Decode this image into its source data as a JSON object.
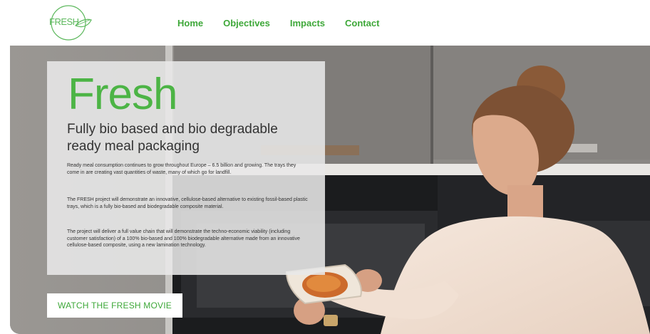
{
  "header": {
    "logo_text": "FRESH",
    "nav": [
      "Home",
      "Objectives",
      "Impacts",
      "Contact"
    ]
  },
  "hero": {
    "title": "Fresh",
    "subtitle": "Fully bio based and bio degradable ready meal packaging",
    "paragraphs": [
      "Ready meal consumption continues to grow throughout Europe – 6.5 billion and growing. The trays they come in are creating vast quantities of waste, many of which go for landfill.",
      "The FRESH project will demonstrate an innovative, cellulose-based alternative to existing fossil-based plastic trays, which is a fully bio-based and biodegradable composite material.",
      "The project will deliver a full value chain that will demonstrate the techno-economic viability (including customer satisfaction) of a 100% bio-based and 100% biodegradable alternative made from an innovative cellulose-based composite, using a new lamination technology."
    ],
    "cta_label": "WATCH THE FRESH MOVIE"
  },
  "colors": {
    "brand_green": "#3ea839",
    "title_green": "#4cb445",
    "panel": "#e8e8e8"
  }
}
